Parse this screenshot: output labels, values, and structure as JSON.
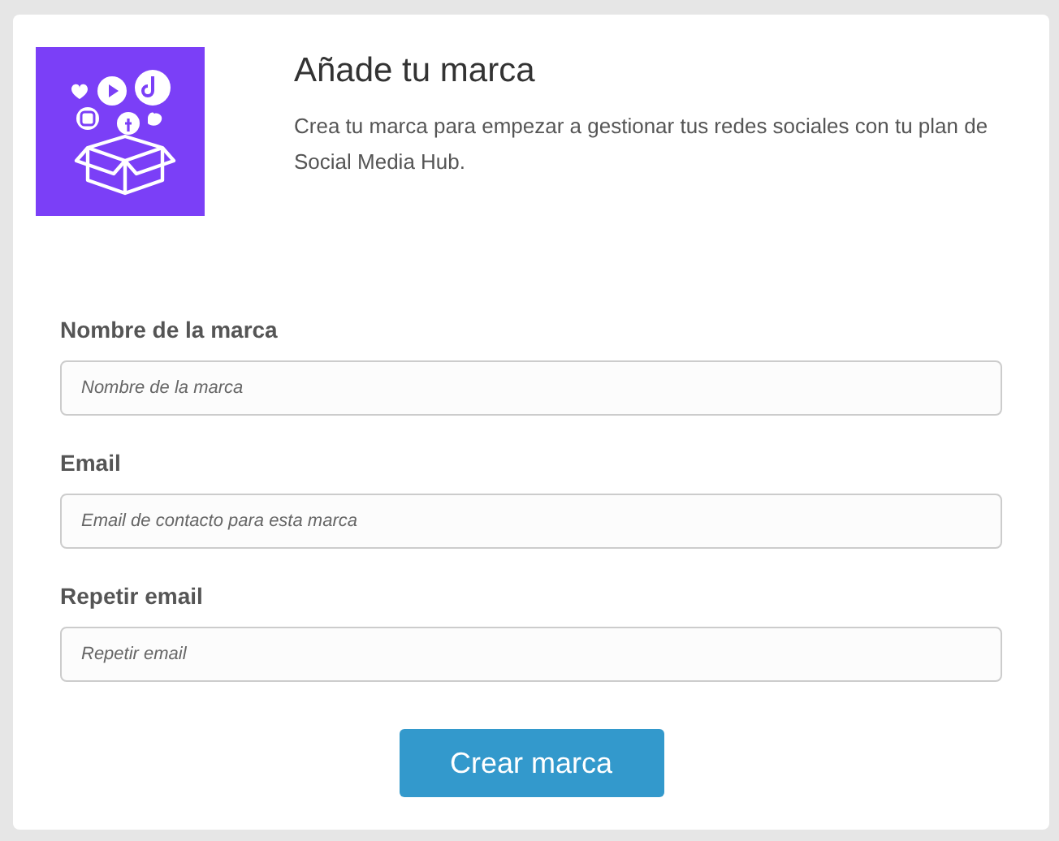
{
  "header": {
    "title": "Añade tu marca",
    "description": "Crea tu marca para empezar a gestionar tus redes sociales con tu plan de Social Media Hub."
  },
  "fields": [
    {
      "label": "Nombre de la marca",
      "placeholder": "Nombre de la marca"
    },
    {
      "label": "Email",
      "placeholder": "Email de contacto para esta marca"
    },
    {
      "label": "Repetir email",
      "placeholder": "Repetir email"
    }
  ],
  "submit": {
    "label": "Crear marca"
  }
}
